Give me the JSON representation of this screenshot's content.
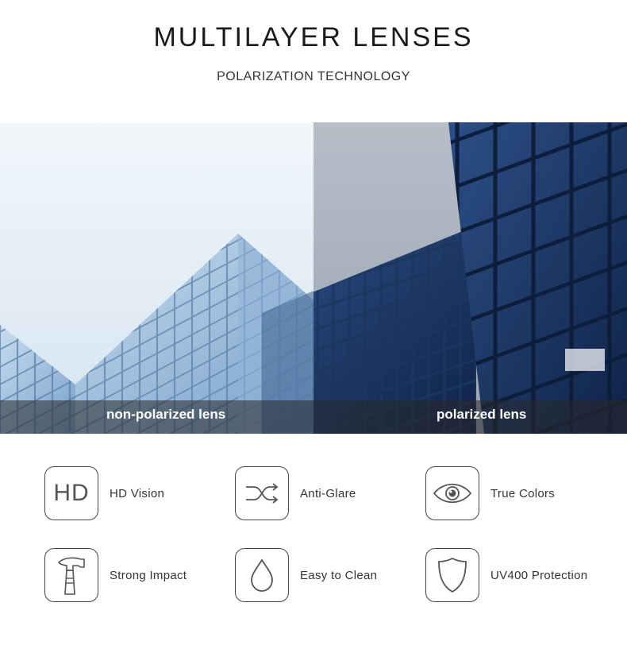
{
  "header": {
    "title": "MULTILAYER LENSES",
    "subtitle": "POLARIZATION TECHNOLOGY"
  },
  "comparison": {
    "left_label": "non-polarized lens",
    "right_label": "polarized lens"
  },
  "features": [
    {
      "label": "HD Vision",
      "icon": "hd-icon",
      "icon_text": "HD"
    },
    {
      "label": "Anti-Glare",
      "icon": "shuffle-arrows-icon"
    },
    {
      "label": "True Colors",
      "icon": "eye-icon"
    },
    {
      "label": "Strong Impact",
      "icon": "hammer-icon"
    },
    {
      "label": "Easy to Clean",
      "icon": "water-drop-icon"
    },
    {
      "label": "UV400 Protection",
      "icon": "shield-icon"
    }
  ],
  "colors": {
    "text": "#222222",
    "icon_border": "#444444",
    "sky_left": "#dfeaf3",
    "sky_right": "#a7b1bf",
    "glass_dark": "#1f3a66",
    "label_bar": "rgba(40,40,40,0.55)"
  }
}
